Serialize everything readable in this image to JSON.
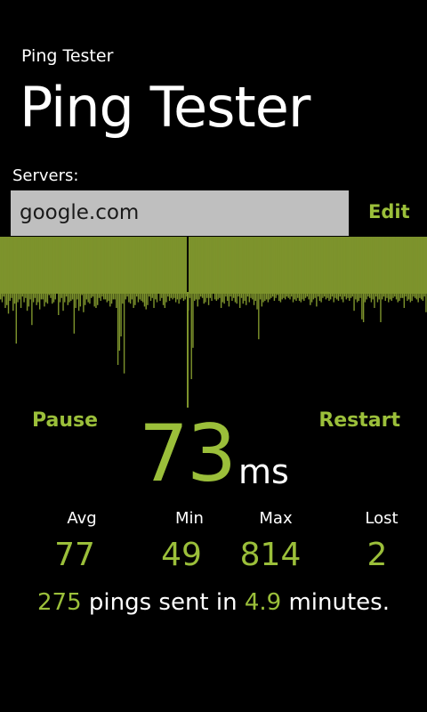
{
  "header": {
    "app_label": "Ping Tester",
    "page_title": "Ping Tester"
  },
  "servers": {
    "label": "Servers:",
    "value": "google.com",
    "edit_label": "Edit"
  },
  "controls": {
    "pause_label": "Pause",
    "restart_label": "Restart"
  },
  "current": {
    "value": "73",
    "unit": "ms"
  },
  "stats": {
    "avg_label": "Avg",
    "avg_value": "77",
    "min_label": "Min",
    "min_value": "49",
    "max_label": "Max",
    "max_value": "814",
    "lost_label": "Lost",
    "lost_value": "2"
  },
  "summary": {
    "count": "275",
    "text_mid": "pings sent in",
    "minutes": "4.9",
    "text_end": "minutes."
  },
  "colors": {
    "accent": "#9bbf3a",
    "bar": "#7d932c",
    "background": "#000000",
    "input_bg": "#bfbfbf"
  },
  "chart_data": {
    "type": "bar",
    "values": [
      64,
      66,
      62,
      70,
      68,
      74,
      65,
      63,
      72,
      67,
      95,
      66,
      64,
      70,
      62,
      66,
      63,
      72,
      69,
      64,
      82,
      66,
      63,
      68,
      66,
      71,
      64,
      64,
      69,
      66,
      67,
      61,
      63,
      67,
      66,
      64,
      60,
      75,
      66,
      63,
      72,
      66,
      62,
      68,
      66,
      65,
      64,
      88,
      70,
      64,
      72,
      69,
      61,
      73,
      68,
      64,
      66,
      67,
      63,
      62,
      69,
      70,
      68,
      63,
      65,
      62,
      64,
      64,
      66,
      65,
      69,
      67,
      64,
      64,
      70,
      110,
      100,
      90,
      67,
      116,
      64,
      62,
      66,
      67,
      64,
      70,
      68,
      62,
      66,
      64,
      65,
      66,
      69,
      71,
      68,
      62,
      65,
      63,
      70,
      64,
      66,
      60,
      65,
      63,
      68,
      70,
      66,
      62,
      65,
      63,
      64,
      63,
      66,
      64,
      67,
      64,
      63,
      65,
      64,
      62,
      72,
      63,
      120,
      98,
      65,
      64,
      69,
      64,
      62,
      63,
      67,
      66,
      63,
      68,
      63,
      65,
      60,
      64,
      65,
      64,
      63,
      70,
      66,
      67,
      62,
      65,
      69,
      62,
      65,
      63,
      66,
      67,
      62,
      70,
      63,
      67,
      65,
      68,
      62,
      66,
      63,
      64,
      68,
      65,
      71,
      92,
      64,
      69,
      66,
      65,
      64,
      66,
      64,
      63,
      62,
      65,
      63,
      61,
      65,
      66,
      64,
      63,
      64,
      62,
      63,
      64,
      62,
      66,
      64,
      65,
      63,
      65,
      66,
      64,
      65,
      63,
      62,
      64,
      68,
      66,
      64,
      63,
      69,
      62,
      65,
      66,
      63,
      62,
      64,
      63,
      65,
      64,
      62,
      66,
      63,
      64,
      65,
      62,
      64,
      66,
      62,
      64,
      63,
      65,
      63,
      62,
      72,
      64,
      66,
      65,
      63,
      78,
      80,
      66,
      64,
      62,
      63,
      66,
      64,
      70,
      62,
      66,
      64,
      80,
      64,
      62,
      65,
      63,
      66,
      64,
      65,
      63,
      62,
      64,
      66,
      65,
      63,
      63,
      70,
      62,
      65,
      64,
      66,
      65,
      62,
      63,
      64,
      66,
      63,
      64,
      65,
      62,
      73
    ],
    "markers": [
      814
    ],
    "ylim": [
      0,
      820
    ]
  }
}
